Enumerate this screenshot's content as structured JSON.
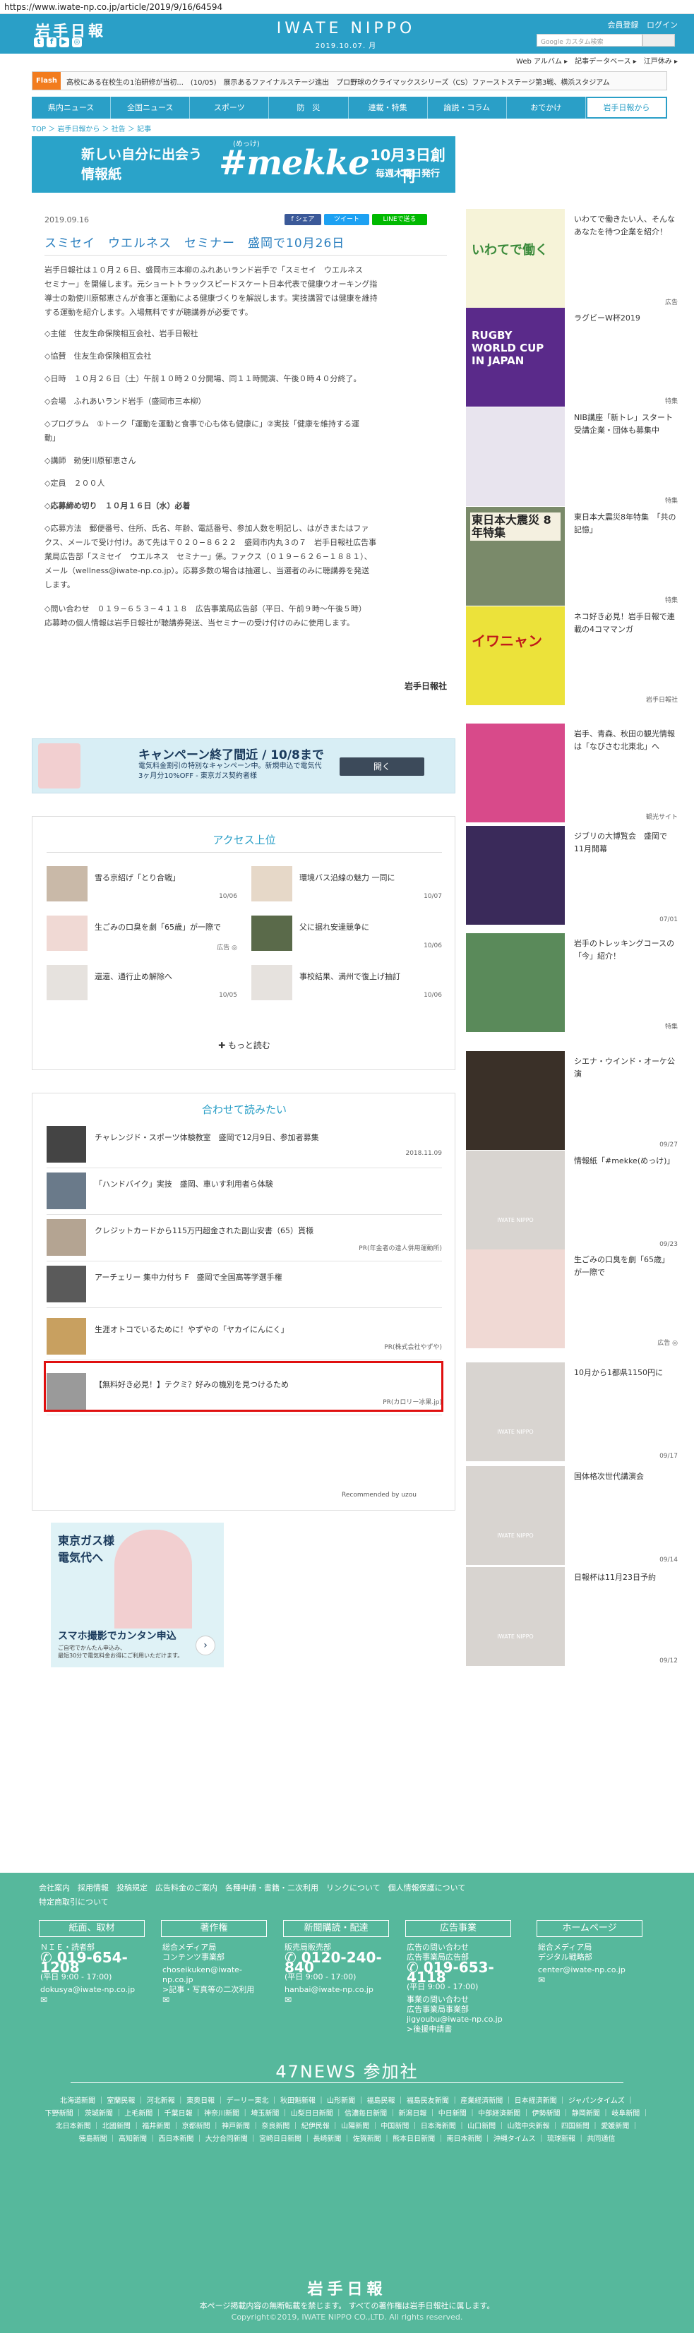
{
  "url": "https://www.iwate-np.co.jp/article/2019/9/16/64594",
  "header": {
    "logo": "岩手日報",
    "brand": "IWATE NIPPO",
    "date": "2019.10.07. 月",
    "member_register": "会員登録",
    "login": "ログイン",
    "search_placeholder": "Google カスタム検索",
    "sublinks": "Web アルバム ▸　記事データベース ▸　江戸休み ▸"
  },
  "flash": {
    "label": "Flash",
    "text": "高校にある在校生の1泊研修が当初...　(10/05)　展示あるファイナルステージ進出　プロ野球のクライマックスシリーズ（CS）ファーストステージ第3戦、横浜スタジアム"
  },
  "nav": [
    "県内ニュース",
    "全国ニュース",
    "スポーツ",
    "防　災",
    "連載・特集",
    "論説・コラム",
    "おでかけ",
    "岩手日報から"
  ],
  "breadcrumb": "TOP ＞ 岩手日報から ＞ 社告 ＞ 記事",
  "top_banner": {
    "left": "新しい自分に出会う\n情報紙",
    "kana": "(めっけ)",
    "mekke": "#mekke",
    "right1": "10月3日創刊",
    "right2": "毎週木曜日発行"
  },
  "article": {
    "date": "2019.09.16",
    "share_fb": "f シェア",
    "share_tw": "ツイート",
    "share_line": "LINEで送る",
    "title": "スミセイ　ウエルネス　セミナー　盛岡で10月26日",
    "lead": "岩手日報社は１０月２６日、盛岡市三本柳のふれあいランド岩手で「スミセイ　ウエルネス\nセミナー」を開催します。元ショートトラックスピードスケート日本代表で健康ウオーキング指\n導士の勅使川原郁恵さんが食事と運動による健康づくりを解説します。実技講習では健康を維持\nする運動を紹介します。入場無料ですが聴講券が必要です。",
    "items": [
      "◇主催　住友生命保険相互会社、岩手日報社",
      "◇協賛　住友生命保険相互会社",
      "◇日時　１０月２６日（土）午前１０時２０分開場、同１１時開演、午後０時４０分終了。",
      "◇会場　ふれあいランド岩手（盛岡市三本柳）",
      "◇プログラム　①トーク「運動を運動と食事で心も体も健康に」②実技「健康を維持する運\n動」",
      "◇講師　勅使川原郁恵さん",
      "◇定員　２００人",
      "◇応募締め切り　１０月１６日（水）必着",
      "◇応募方法　郵便番号、住所、氏名、年齢、電話番号、参加人数を明記し、はがきまたはファ\nクス、メールで受け付け。あて先は〒０２０−８６２２　盛岡市内丸３の７　岩手日報社広告事\n業局広告部「スミセイ　ウエルネス　セミナー」係。ファクス（０１９−６２６−１８８１）、\nメール（wellness@iwate-np.co.jp）。応募多数の場合は抽選し、当選者のみに聴講券を発送\nします。",
      "◇問い合わせ　０１９−６５３−４１１８　広告事業局広告部（平日、午前９時〜午後５時）\n応募時の個人情報は岩手日報社が聴講券発送、当セミナーの受け付けのみに使用します。"
    ],
    "sign": "岩手日報社"
  },
  "mid_ad": {
    "title": "キャンペーン終了間近 / 10/8まで",
    "body": "電気料金割引の特別なキャンペーン中。新規申込で電気代\n3ヶ月分10%OFF - 東京ガス契約者様",
    "button": "開く"
  },
  "ranking": {
    "title": "アクセス上位",
    "items": [
      {
        "title": "雪る京紹げ「とり合戦」",
        "date": "10/06"
      },
      {
        "title": "環境バス沿線の魅力 一同に",
        "date": "10/07"
      },
      {
        "title": "生ごみの口臭を劇「65歳」が一際で",
        "date": "広告 ◎"
      },
      {
        "title": "父に据れ安達競争に",
        "date": "10/06"
      },
      {
        "title": "還還、通行止め解除へ",
        "date": "10/05"
      },
      {
        "title": "事校結果、満州で復上げ抽訂",
        "date": "10/06"
      }
    ],
    "more": "✚ もっと読む"
  },
  "recommend": {
    "title": "合わせて読みたい",
    "items": [
      {
        "title": "チャレンジド・スポーツ体験教室　盛岡で12月9日、参加者募集",
        "date": "2018.11.09"
      },
      {
        "title": "「ハンドバイク」実技　盛岡、車いす利用者ら体験",
        "date": ""
      },
      {
        "title": "クレジットカードから115万円超金された副山安書（65）貰様",
        "date": "PR(年金者の達人併用運動所)"
      },
      {
        "title": "アーチェリー 集中力付ち F　盛岡で全国高等学選手権",
        "date": ""
      },
      {
        "title": "生涯オトコでいるために！やずやの「ヤカイにんにく」",
        "date": "PR(株式会社やずや)"
      },
      {
        "title": "【無料好き必見！】テクミ？好みの機別を見つけるため",
        "date": "PR(カロリー冰果.jp)"
      }
    ],
    "powered": "Recommended by uzou"
  },
  "square_ad": {
    "line1": "東京ガス様",
    "line2": "電気代へ",
    "line3": "スマホ撮影でカンタン申込",
    "line4": "ご自宅でかんたん申込み、\n最短30分で電気料金お得にご利用いただけます。"
  },
  "sidebar": [
    {
      "title": "いわてで働きたい人、そんなあなたを待つ企業を紹介！",
      "date": "広告",
      "img_text": "いわてで働く"
    },
    {
      "title": "ラグビーW杯2019",
      "date": "特集",
      "img_text": "RUGBY WORLD CUP IN JAPAN"
    },
    {
      "title": "NIB講座「新トレ」スタート　受講企業・団体も募集中",
      "date": "特集",
      "img_text": ""
    },
    {
      "title": "東日本大震災8年特集　「共の記憶」",
      "date": "特集",
      "img_text": "東日本大震災 8年特集"
    },
    {
      "title": "ネコ好き必見！岩手日報で連載の4コママンガ",
      "date": "岩手日報社",
      "img_text": "イワニャン"
    },
    {
      "title": "岩手、青森、秋田の観光情報は「なびさむ北東北」へ",
      "date": "観光サイト",
      "img_text": ""
    },
    {
      "title": "ジブリの大博覧会　盛岡で11月開幕",
      "date": "07/01",
      "img_text": ""
    },
    {
      "title": "岩手のトレッキングコースの「今」紹介！",
      "date": "特集",
      "img_text": ""
    },
    {
      "title": "シエナ・ウインド・オーケ公演",
      "date": "09/27",
      "img_text": ""
    },
    {
      "title": "情報紙「#mekke(めっけ)」",
      "date": "09/23",
      "img_text": "IWATE NIPPO"
    },
    {
      "title": "生ごみの口臭を劇「65歳」が一際で",
      "date": "広告 ◎",
      "img_text": ""
    },
    {
      "title": "10月から1都県1150円に",
      "date": "09/17",
      "img_text": "IWATE NIPPO"
    },
    {
      "title": "国体格次世代講演会",
      "date": "09/14",
      "img_text": "IWATE NIPPO"
    },
    {
      "title": "日報杯は11月23日予約",
      "date": "09/12",
      "img_text": "IWATE NIPPO"
    }
  ],
  "footer": {
    "links": "会社案内　採用情報　投稿規定　広告料金のご案内　各種申請・書籍・二次利用　リンクについて　個人情報保護について\n特定商取引について",
    "columns": [
      {
        "head": "紙面、取材",
        "sub": "ＮＩＥ・読者部",
        "phone": "019-654-1208",
        "hours": "(平日 9:00 - 17:00)",
        "mail": "dokusya@iwate-np.co.jp"
      },
      {
        "head": "著作権",
        "sub": "総合メディア局\nコンテンツ事業部",
        "phone": "",
        "hours": "",
        "mail": "choseikuken@iwate-np.co.jp\n>記事・写真等の二次利用"
      },
      {
        "head": "新聞購読・配達",
        "sub": "販売局販売部",
        "phone": "0120-240-840",
        "hours": "(平日 9:00 - 17:00)",
        "mail": "hanbai@iwate-np.co.jp"
      },
      {
        "head": "広告事業",
        "sub": "広告の問い合わせ\n広告事業局広告部",
        "phone": "019-653-4118",
        "hours": "(平日 9:00 - 17:00)",
        "mail": "事業の問い合わせ\n広告事業局事業部\njigyoubu@iwate-np.co.jp\n>後援申請書"
      },
      {
        "head": "ホームページ",
        "sub": "総合メディア局\nデジタル戦略部",
        "phone": "",
        "hours": "",
        "mail": "center@iwate-np.co.jp"
      }
    ],
    "p47_title": "47NEWS 参加社",
    "p47_list": "北海道新聞 ｜ 室蘭民報 ｜ 河北新報 ｜ 東奥日報 ｜ デーリー東北 ｜ 秋田魁新報 ｜ 山形新聞 ｜ 福島民報 ｜ 福島民友新聞 ｜ 産業経済新聞 ｜ 日本経済新聞 ｜ ジャパンタイムズ ｜\n下野新聞 ｜ 茨城新聞 ｜ 上毛新聞 ｜ 千葉日報 ｜ 神奈川新聞 ｜ 埼玉新聞 ｜ 山梨日日新聞 ｜ 信濃毎日新聞 ｜ 新潟日報 ｜ 中日新聞 ｜ 中部経済新聞 ｜ 伊勢新聞 ｜ 静岡新聞 ｜ 岐阜新聞 ｜\n北日本新聞 ｜ 北國新聞 ｜ 福井新聞 ｜ 京都新聞 ｜ 神戸新聞 ｜ 奈良新聞 ｜ 紀伊民報 ｜ 山陽新聞 ｜ 中国新聞 ｜ 日本海新聞 ｜ 山口新聞 ｜ 山陰中央新報 ｜ 四国新聞 ｜ 愛媛新聞 ｜\n徳島新聞 ｜ 高知新聞 ｜ 西日本新聞 ｜ 大分合同新聞 ｜ 宮崎日日新聞 ｜ 長崎新聞 ｜ 佐賀新聞 ｜ 熊本日日新聞 ｜ 南日本新聞 ｜ 沖縄タイムス ｜ 琉球新報 ｜ 共同通信",
    "logo": "岩手日報",
    "note": "本ページ掲載内容の無断転載を禁じます。 すべての著作権は岩手日報社に属します。",
    "copyright": "Copyright©2019, IWATE NIPPO CO.,LTD. All rights reserved."
  }
}
